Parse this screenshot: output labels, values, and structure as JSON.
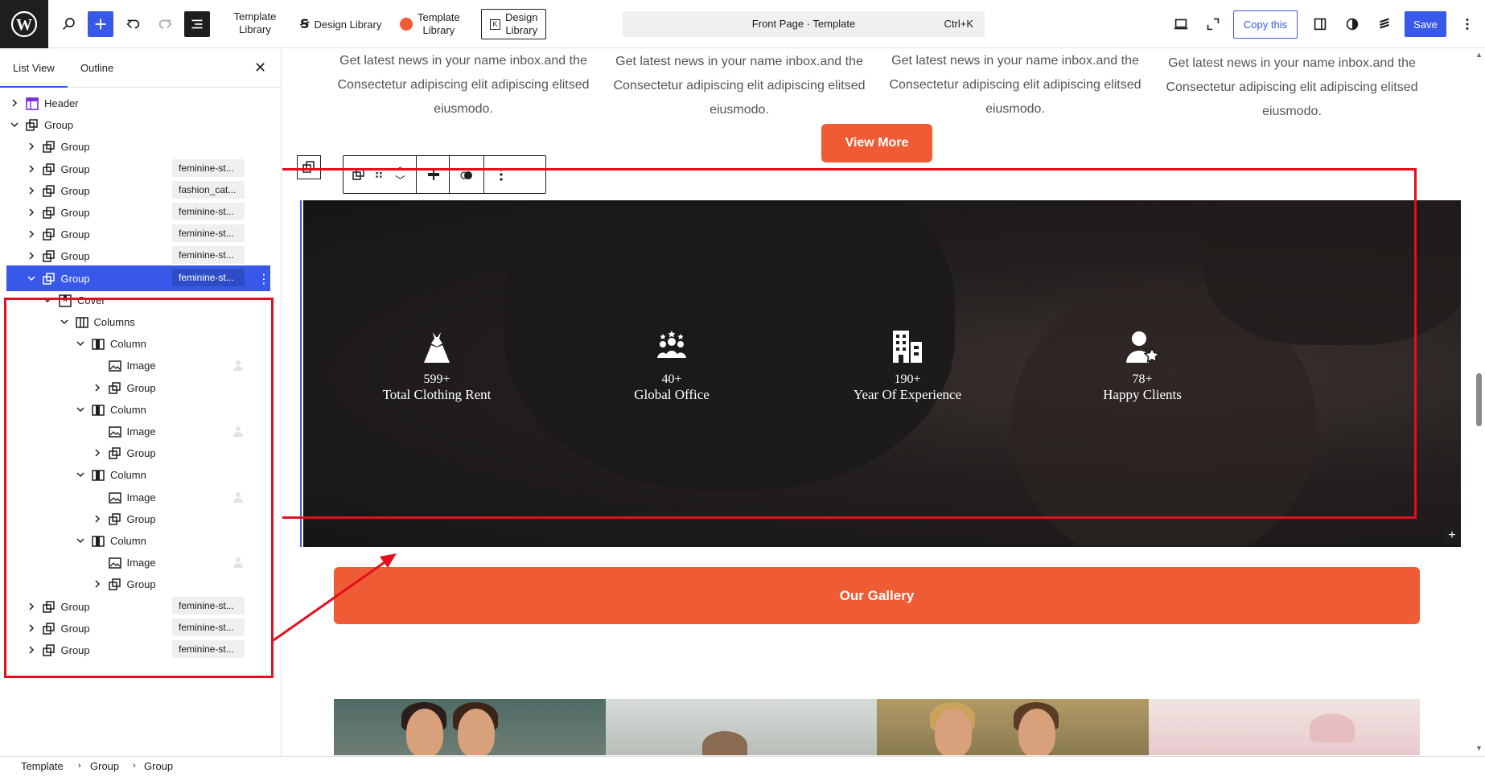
{
  "toolbar": {
    "template_library_1": "Template\nLibrary",
    "design_library_1": "Design Library",
    "template_library_2": "Template\nLibrary",
    "design_library_2": "Design\nLibrary",
    "search_title": "Front Page · Template",
    "search_shortcut": "Ctrl+K",
    "copy_label": "Copy this",
    "save_label": "Save"
  },
  "panel": {
    "tab_list": "List View",
    "tab_outline": "Outline",
    "rows": [
      {
        "label": "Header",
        "tag": ""
      },
      {
        "label": "Group",
        "tag": ""
      },
      {
        "label": "Group",
        "tag": ""
      },
      {
        "label": "Group",
        "tag": "feminine-st..."
      },
      {
        "label": "Group",
        "tag": "fashion_cat..."
      },
      {
        "label": "Group",
        "tag": "feminine-st..."
      },
      {
        "label": "Group",
        "tag": "feminine-st..."
      },
      {
        "label": "Group",
        "tag": "feminine-st..."
      },
      {
        "label": "Group",
        "tag": "feminine-st..."
      },
      {
        "label": "Cover",
        "tag": ""
      },
      {
        "label": "Columns",
        "tag": ""
      },
      {
        "label": "Column",
        "tag": ""
      },
      {
        "label": "Image",
        "tag": ""
      },
      {
        "label": "Group",
        "tag": ""
      },
      {
        "label": "Column",
        "tag": ""
      },
      {
        "label": "Image",
        "tag": ""
      },
      {
        "label": "Group",
        "tag": ""
      },
      {
        "label": "Column",
        "tag": ""
      },
      {
        "label": "Image",
        "tag": ""
      },
      {
        "label": "Group",
        "tag": ""
      },
      {
        "label": "Column",
        "tag": ""
      },
      {
        "label": "Image",
        "tag": ""
      },
      {
        "label": "Group",
        "tag": ""
      },
      {
        "label": "Group",
        "tag": "feminine-st..."
      },
      {
        "label": "Group",
        "tag": "feminine-st..."
      },
      {
        "label": "Group",
        "tag": "feminine-st..."
      }
    ]
  },
  "breadcrumb": [
    "Template",
    "Group",
    "Group"
  ],
  "canvas": {
    "news_text": "Get latest news in your name inbox.and the Consectetur adipiscing elit adipiscing elitsed eiusmodo.",
    "view_more": "View More",
    "stats": [
      {
        "num": "599+",
        "label": "Total Clothing Rent",
        "icon": "dress-icon"
      },
      {
        "num": "40+",
        "label": "Global Office",
        "icon": "team-icon"
      },
      {
        "num": "190+",
        "label": "Year Of Experience",
        "icon": "building-icon"
      },
      {
        "num": "78+",
        "label": "Happy Clients",
        "icon": "user-star-icon"
      }
    ],
    "gallery_button": "Our Gallery"
  },
  "colors": {
    "accent": "#3858e9",
    "brand_orange": "#ef5b35",
    "highlight_red": "#e2101e"
  }
}
